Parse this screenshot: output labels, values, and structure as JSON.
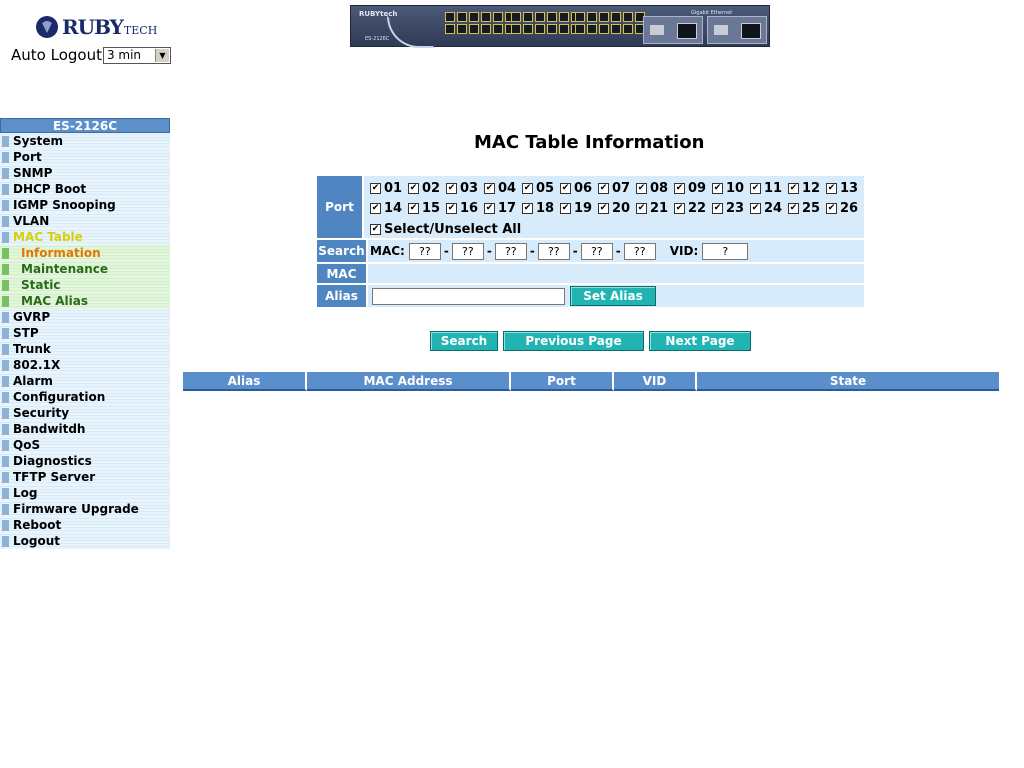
{
  "brand": {
    "name": "RUBY",
    "suffix": "TECH"
  },
  "auto_logout": {
    "label": "Auto Logout",
    "value": "3 min"
  },
  "device": {
    "brand": "RUBYtech",
    "model": "ES-2126C",
    "gbe_label": "Gigabit Ethernet"
  },
  "menu": {
    "header": "ES-2126C",
    "items": [
      {
        "label": "System"
      },
      {
        "label": "Port"
      },
      {
        "label": "SNMP"
      },
      {
        "label": "DHCP Boot"
      },
      {
        "label": "IGMP Snooping"
      },
      {
        "label": "VLAN"
      },
      {
        "label": "MAC Table",
        "active": true
      },
      {
        "label": "Information",
        "sub": true,
        "current": true
      },
      {
        "label": "Maintenance",
        "sub": true
      },
      {
        "label": "Static",
        "sub": true
      },
      {
        "label": "MAC Alias",
        "sub": true
      },
      {
        "label": "GVRP"
      },
      {
        "label": "STP"
      },
      {
        "label": "Trunk"
      },
      {
        "label": "802.1X"
      },
      {
        "label": "Alarm"
      },
      {
        "label": "Configuration"
      },
      {
        "label": "Security"
      },
      {
        "label": "Bandwitdh"
      },
      {
        "label": "QoS"
      },
      {
        "label": "Diagnostics"
      },
      {
        "label": "TFTP Server"
      },
      {
        "label": "Log"
      },
      {
        "label": "Firmware Upgrade"
      },
      {
        "label": "Reboot"
      },
      {
        "label": "Logout"
      }
    ]
  },
  "page": {
    "title": "MAC Table Information"
  },
  "form": {
    "port_label": "Port",
    "ports_row1": [
      "01",
      "02",
      "03",
      "04",
      "05",
      "06",
      "07",
      "08",
      "09",
      "10",
      "11",
      "12",
      "13"
    ],
    "ports_row2": [
      "14",
      "15",
      "16",
      "17",
      "18",
      "19",
      "20",
      "21",
      "22",
      "23",
      "24",
      "25",
      "26"
    ],
    "select_all_label": "Select/Unselect All",
    "search_label": "Search",
    "mac_prefix": "MAC:",
    "mac_octets": [
      "??",
      "??",
      "??",
      "??",
      "??",
      "??"
    ],
    "vid_label": "VID:",
    "vid_value": "?",
    "mac_label": "MAC",
    "alias_label": "Alias",
    "alias_value": "",
    "set_alias_button": "Set Alias"
  },
  "buttons": {
    "search": "Search",
    "previous": "Previous Page",
    "next": "Next Page"
  },
  "table": {
    "headers": [
      "Alias",
      "MAC Address",
      "Port",
      "VID",
      "State"
    ]
  },
  "colors": {
    "header_blue": "#5a8fcb",
    "button_teal": "#22b3b3",
    "cell_light": "#d7ebfb"
  }
}
